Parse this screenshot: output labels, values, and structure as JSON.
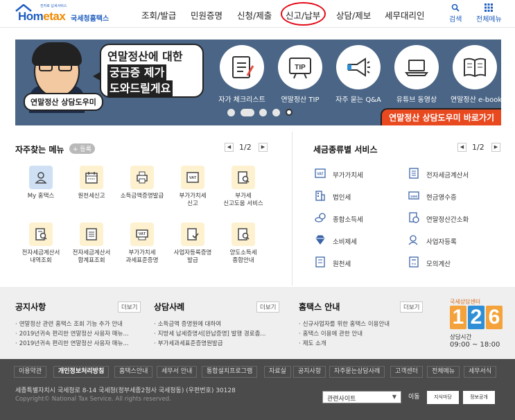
{
  "header": {
    "logo_brand_a": "Hom",
    "logo_brand_b": "etax",
    "logo_tagline": "전자로 납세서비스",
    "logo_sub": "국세청홈택스",
    "gnb": [
      "조회/발급",
      "민원증명",
      "신청/제출",
      "신고/납부",
      "상담/제보",
      "세무대리인"
    ],
    "search_label": "검색",
    "menu_label": "전체메뉴"
  },
  "banner": {
    "bubble_lines": [
      "연말정산에 대한",
      "궁금증 제가",
      "도와드릴게요"
    ],
    "helper_label": "연말정산 상담도우미",
    "icons": [
      {
        "label": "자가 체크리스트",
        "icon": "checklist-icon"
      },
      {
        "label": "연말정산 TIP",
        "icon": "tip-icon"
      },
      {
        "label": "자주 묻는 Q&A",
        "icon": "megaphone-icon"
      },
      {
        "label": "유튜브 동영상",
        "icon": "laptop-icon"
      },
      {
        "label": "연말정산 e-book",
        "icon": "book-icon"
      }
    ],
    "cta": "연말정산 상담도우미 바로가기"
  },
  "favorites": {
    "title": "자주찾는 메뉴",
    "register": "+ 등록",
    "page": "1/2",
    "items": [
      {
        "label": "My 홈택스",
        "icon": "person-icon",
        "blue": true
      },
      {
        "label": "원천세신고",
        "icon": "calendar-icon"
      },
      {
        "label": "소득금액증명발급",
        "icon": "printer-icon"
      },
      {
        "label": "부가가치세\n신고",
        "icon": "vat-icon"
      },
      {
        "label": "부가세\n신고도움 서비스",
        "icon": "doc-search-icon"
      },
      {
        "label": "전자세금계산서\n내역조회",
        "icon": "doc-search-icon"
      },
      {
        "label": "전자세금계산서\n합계표조회",
        "icon": "doc-grid-icon"
      },
      {
        "label": "부가가치세\n과세표준증명",
        "icon": "vat-print-icon"
      },
      {
        "label": "사업자등록증명\n발급",
        "icon": "doc-check-icon"
      },
      {
        "label": "양도소득세\n종합안내",
        "icon": "doc-search-icon"
      }
    ]
  },
  "tax_services": {
    "title": "세금종류별 서비스",
    "page": "1/2",
    "items": [
      {
        "label": "부가가치세",
        "icon": "vat-icon"
      },
      {
        "label": "전자세금계산서",
        "icon": "invoice-icon"
      },
      {
        "label": "법인세",
        "icon": "building-icon"
      },
      {
        "label": "현금영수증",
        "icon": "receipt-icon"
      },
      {
        "label": "종합소득세",
        "icon": "coins-icon"
      },
      {
        "label": "연말정산간소화",
        "icon": "doc-coin-icon"
      },
      {
        "label": "소비제세",
        "icon": "diamond-icon"
      },
      {
        "label": "사업자등록",
        "icon": "user-search-icon"
      },
      {
        "label": "원천세",
        "icon": "document-icon"
      },
      {
        "label": "모의계산",
        "icon": "calculator-icon"
      }
    ]
  },
  "notices": {
    "more": "더보기",
    "columns": [
      {
        "title": "공지사항",
        "items": [
          "연말정산 관련 홈택스 조회 기능 추가 안내",
          "2019년귀속 편리한 연말정산 사용자 매뉴...",
          "2019년귀속 편리한 연말정산 사용자 매뉴..."
        ]
      },
      {
        "title": "상담사례",
        "items": [
          "소득금액 증명원에 대하여",
          "지방세 납세증명서[완납증명] 발행 경로좀...",
          "부가세과세표준증명원발급"
        ]
      },
      {
        "title": "홈택스 안내",
        "items": [
          "신규사업자를 위한 홈택스 이용안내",
          "홈택스 이용에 관한 안내",
          "제도 소개"
        ]
      }
    ]
  },
  "call_center": {
    "top": "국세상담센터",
    "digits": [
      "1",
      "2",
      "6"
    ],
    "digit_colors": [
      "#f4a23b",
      "#2f8fd6",
      "#f4a23b"
    ],
    "hours_label": "상담시간",
    "hours": "09:00 ~ 18:00"
  },
  "footer": {
    "links": [
      "이용약관",
      "개인정보처리방침",
      "홈택스안내",
      "세무서 안내",
      "통합설치프로그램",
      "자료실",
      "공지사항",
      "자주묻는상담사례",
      "고객센터",
      "전체메뉴",
      "세무서식"
    ],
    "address": "세종특별자치시 국세청로 8-14 국세청(정부세종2청사 국세청동) (우편번호) 30128",
    "copyright": "Copyright© National Tax Service. All rights reserved.",
    "select_label": "관련사이트",
    "go_label": "이동",
    "badge1": "지식마당",
    "badge2": "정보공개"
  }
}
